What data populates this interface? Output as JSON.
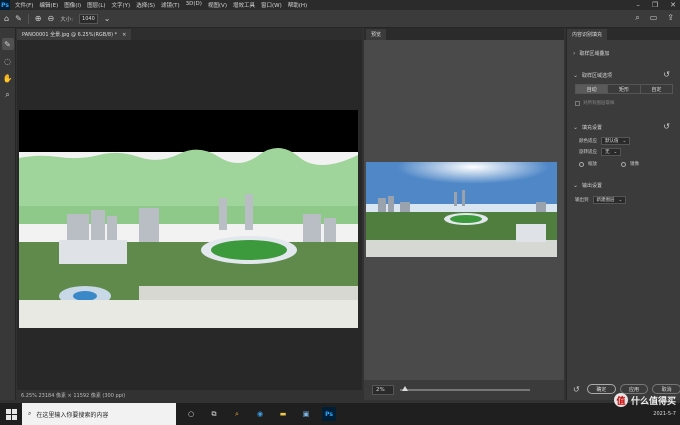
{
  "app": {
    "logo": "Ps"
  },
  "menu": [
    "文件(F)",
    "编辑(E)",
    "图像(I)",
    "图层(L)",
    "文字(Y)",
    "选择(S)",
    "滤镜(T)",
    "3D(D)",
    "视图(V)",
    "增效工具",
    "窗口(W)",
    "帮助(H)"
  ],
  "options": {
    "size_label": "大小:",
    "size_value": "1040"
  },
  "document": {
    "tab_title": "PANO0001 全景.jpg @ 6.25%(RGB/8) *",
    "status": "6.25%   23184 像素 × 11592 像素 (300 ppi)"
  },
  "preview": {
    "tab": "预览",
    "zoom": "2%"
  },
  "props": {
    "tab": "内容识别填充",
    "section_sample_overlay": "取样区域叠加",
    "section_sample_options": "取样区域选项",
    "seg_auto": "自动",
    "seg_rect": "矩形",
    "seg_custom": "自定",
    "sample_all_layers": "对所有图层取样",
    "section_fill": "填充设置",
    "color_adapt_label": "颜色适应",
    "color_adapt_value": "默认值",
    "rotate_adapt_label": "旋转适应",
    "rotate_adapt_value": "无",
    "scale_label": "缩放",
    "mirror_label": "镜像",
    "section_output": "输出设置",
    "output_to_label": "输出到",
    "output_to_value": "新建图层",
    "btn_ok": "确定",
    "btn_apply": "应用",
    "btn_cancel": "取消"
  },
  "taskbar": {
    "search_placeholder": "在这里输入你要搜索的内容",
    "date": "2021-5-7"
  },
  "watermark": {
    "badge": "值",
    "text": "什么值得买"
  }
}
